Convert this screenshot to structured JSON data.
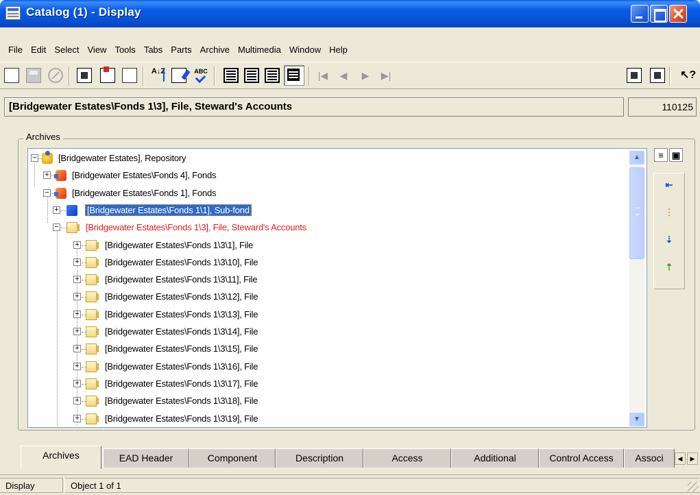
{
  "window": {
    "title": "Catalog (1) - Display"
  },
  "menu": [
    "File",
    "Edit",
    "Select",
    "View",
    "Tools",
    "Tabs",
    "Parts",
    "Archive",
    "Multimedia",
    "Window",
    "Help"
  ],
  "toolbar": {
    "sort_label": "A↓Z",
    "spell_label": "ABC",
    "nav": [
      "|◀",
      "◀",
      "▶",
      "▶|"
    ],
    "help_label": "↖?"
  },
  "record": {
    "path": "[Bridgewater Estates\\Fonds 1\\3], File, Steward's Accounts",
    "id": "110125"
  },
  "archives": {
    "label": "Archives",
    "tree": [
      {
        "text": "[Bridgewater Estates], Repository",
        "level": 0,
        "icon": "repository-icon",
        "state": "expanded",
        "style": "normal"
      },
      {
        "text": "[Bridgewater Estates\\Fonds 4], Fonds",
        "level": 1,
        "icon": "fonds-icon",
        "state": "collapsed",
        "style": "normal"
      },
      {
        "text": "[Bridgewater Estates\\Fonds 1], Fonds",
        "level": 1,
        "icon": "fonds-icon",
        "state": "expanded",
        "style": "normal"
      },
      {
        "text": "[Bridgewater Estates\\Fonds 1\\1], Sub-fond",
        "level": 2,
        "icon": "subfond-icon",
        "state": "collapsed",
        "style": "selected"
      },
      {
        "text": "[Bridgewater Estates\\Fonds 1\\3], File, Steward's Accounts",
        "level": 2,
        "icon": "file-icon",
        "state": "expanded",
        "style": "highlight"
      },
      {
        "text": "[Bridgewater Estates\\Fonds 1\\3\\1], File",
        "level": 3,
        "icon": "file-icon",
        "state": "collapsed",
        "style": "normal"
      },
      {
        "text": "[Bridgewater Estates\\Fonds 1\\3\\10], File",
        "level": 3,
        "icon": "file-icon",
        "state": "collapsed",
        "style": "normal"
      },
      {
        "text": "[Bridgewater Estates\\Fonds 1\\3\\11], File",
        "level": 3,
        "icon": "file-icon",
        "state": "collapsed",
        "style": "normal"
      },
      {
        "text": "[Bridgewater Estates\\Fonds 1\\3\\12], File",
        "level": 3,
        "icon": "file-icon",
        "state": "collapsed",
        "style": "normal"
      },
      {
        "text": "[Bridgewater Estates\\Fonds 1\\3\\13], File",
        "level": 3,
        "icon": "file-icon",
        "state": "collapsed",
        "style": "normal"
      },
      {
        "text": "[Bridgewater Estates\\Fonds 1\\3\\14], File",
        "level": 3,
        "icon": "file-icon",
        "state": "collapsed",
        "style": "normal"
      },
      {
        "text": "[Bridgewater Estates\\Fonds 1\\3\\15], File",
        "level": 3,
        "icon": "file-icon",
        "state": "collapsed",
        "style": "normal"
      },
      {
        "text": "[Bridgewater Estates\\Fonds 1\\3\\16], File",
        "level": 3,
        "icon": "file-icon",
        "state": "collapsed",
        "style": "normal"
      },
      {
        "text": "[Bridgewater Estates\\Fonds 1\\3\\17], File",
        "level": 3,
        "icon": "file-icon",
        "state": "collapsed",
        "style": "normal"
      },
      {
        "text": "[Bridgewater Estates\\Fonds 1\\3\\18], File",
        "level": 3,
        "icon": "file-icon",
        "state": "collapsed",
        "style": "normal"
      },
      {
        "text": "[Bridgewater Estates\\Fonds 1\\3\\19], File",
        "level": 3,
        "icon": "file-icon",
        "state": "collapsed",
        "style": "normal"
      }
    ]
  },
  "tabs": [
    {
      "label": "Archives",
      "active": true
    },
    {
      "label": "EAD Header",
      "active": false
    },
    {
      "label": "Component",
      "active": false
    },
    {
      "label": "Description",
      "active": false
    },
    {
      "label": "Access",
      "active": false
    },
    {
      "label": "Additional",
      "active": false
    },
    {
      "label": "Control Access",
      "active": false
    },
    {
      "label": "Associ",
      "active": false
    }
  ],
  "status": {
    "mode": "Display",
    "object": "Object 1 of 1"
  },
  "colors": {
    "title_bar": "#0a5ee8",
    "selection": "#316ac5",
    "highlight_text": "#e02020"
  }
}
